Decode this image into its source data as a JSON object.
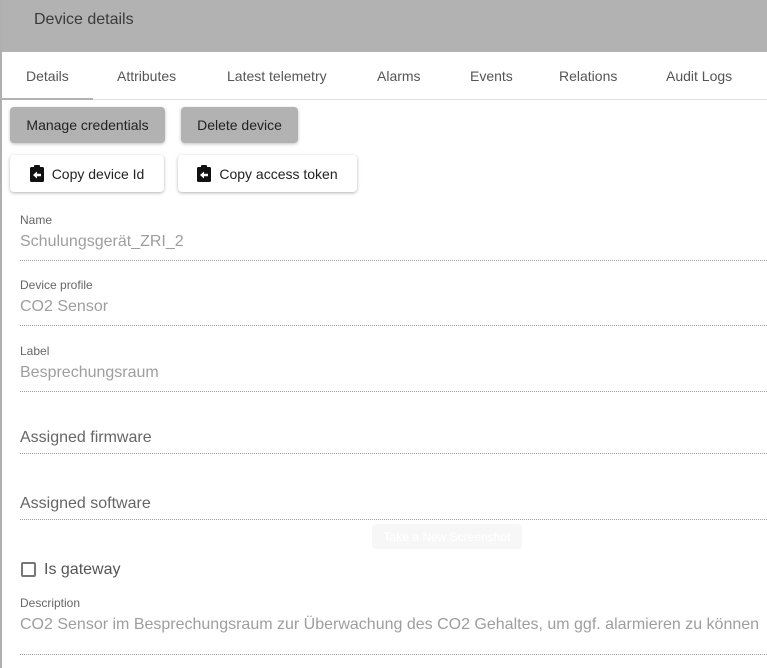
{
  "header": {
    "title": "Device details"
  },
  "tabs": [
    "Details",
    "Attributes",
    "Latest telemetry",
    "Alarms",
    "Events",
    "Relations",
    "Audit Logs"
  ],
  "buttons": {
    "manage_credentials": "Manage credentials",
    "delete_device": "Delete device",
    "copy_device_id": "Copy device Id",
    "copy_access_token": "Copy access token"
  },
  "fields": {
    "name": {
      "label": "Name",
      "value": "Schulungsgerät_ZRI_2"
    },
    "device_profile": {
      "label": "Device profile",
      "value": "CO2 Sensor"
    },
    "label": {
      "label": "Label",
      "value": "Besprechungsraum"
    },
    "assigned_firmware": {
      "placeholder": "Assigned firmware"
    },
    "assigned_software": {
      "placeholder": "Assigned software"
    },
    "is_gateway": {
      "label": "Is gateway",
      "checked": false
    },
    "description": {
      "label": "Description",
      "value": "CO2 Sensor im Besprechungsraum zur Überwachung des CO2 Gehaltes, um ggf. alarmieren zu können"
    }
  },
  "overlay": {
    "text": "Take a New Screenshot"
  }
}
